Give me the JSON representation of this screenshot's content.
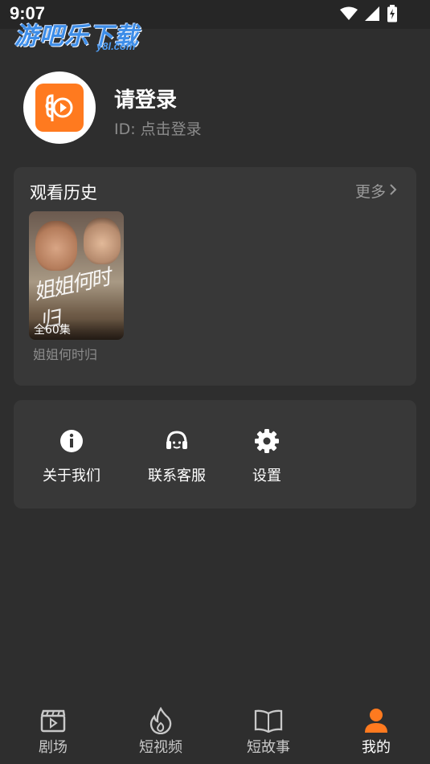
{
  "status_bar": {
    "time": "9:07"
  },
  "watermark": {
    "main": "游吧乐下载",
    "sub": "y8l.com"
  },
  "profile": {
    "name": "请登录",
    "id_text": "ID: 点击登录"
  },
  "history": {
    "title": "观看历史",
    "more_label": "更多",
    "items": [
      {
        "title": "姐姐何时归",
        "episodes": "全60集",
        "poster_text": "姐姐何时归"
      }
    ]
  },
  "menu": {
    "items": [
      {
        "label": "关于我们",
        "icon": "info-icon"
      },
      {
        "label": "联系客服",
        "icon": "headset-icon"
      },
      {
        "label": "设置",
        "icon": "gear-icon"
      }
    ]
  },
  "bottom_nav": {
    "items": [
      {
        "label": "剧场",
        "icon": "clapperboard-icon",
        "active": false
      },
      {
        "label": "短视频",
        "icon": "flame-icon",
        "active": false
      },
      {
        "label": "短故事",
        "icon": "book-icon",
        "active": false
      },
      {
        "label": "我的",
        "icon": "user-icon",
        "active": true
      }
    ]
  },
  "colors": {
    "background": "#2e2e2e",
    "card": "#383838",
    "accent": "#ff7a1f",
    "muted_text": "#8c8c8c",
    "nav_inactive": "#c8c8c8"
  }
}
